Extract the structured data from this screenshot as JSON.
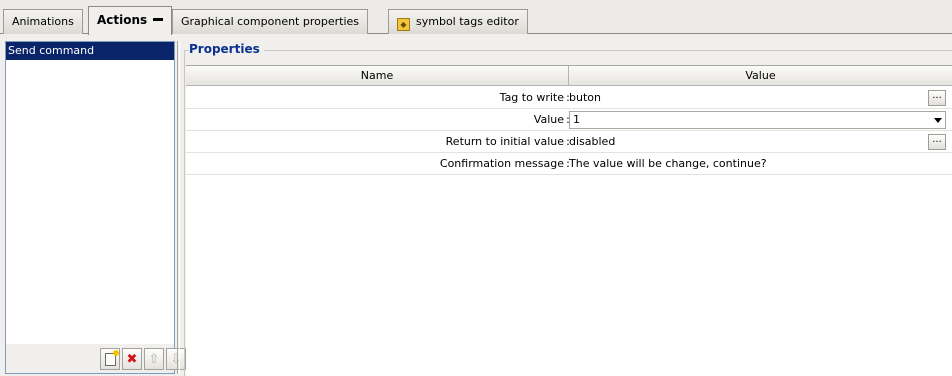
{
  "tabs": [
    {
      "label": "Animations",
      "active": false
    },
    {
      "label": "Actions",
      "active": true
    },
    {
      "label": "Graphical component properties",
      "active": false
    },
    {
      "label": "symbol tags editor",
      "active": false,
      "icon": "tag-icon"
    }
  ],
  "actions_list": {
    "items": [
      "Send command"
    ],
    "selected_index": 0,
    "toolbar": {
      "new_icon": "new-document-icon",
      "delete_icon": "delete-x-icon",
      "up_icon": "arrow-up-icon",
      "down_icon": "arrow-down-icon"
    }
  },
  "properties": {
    "group_title": "Properties",
    "columns": {
      "name": "Name",
      "value": "Value"
    },
    "rows": [
      {
        "name": "Tag to write",
        "value": "buton",
        "editor": "ellipsis"
      },
      {
        "name": "Value",
        "value": "1",
        "editor": "combo"
      },
      {
        "name": "Return to initial value",
        "value": "disabled",
        "editor": "ellipsis"
      },
      {
        "name": "Confirmation message",
        "value": "The value will be change, continue?",
        "editor": "text"
      }
    ],
    "separator": ":",
    "ellipsis_label": "..."
  },
  "colors": {
    "selection": "#0a246a",
    "group_title": "#0b318f",
    "delete": "#d4141a"
  }
}
